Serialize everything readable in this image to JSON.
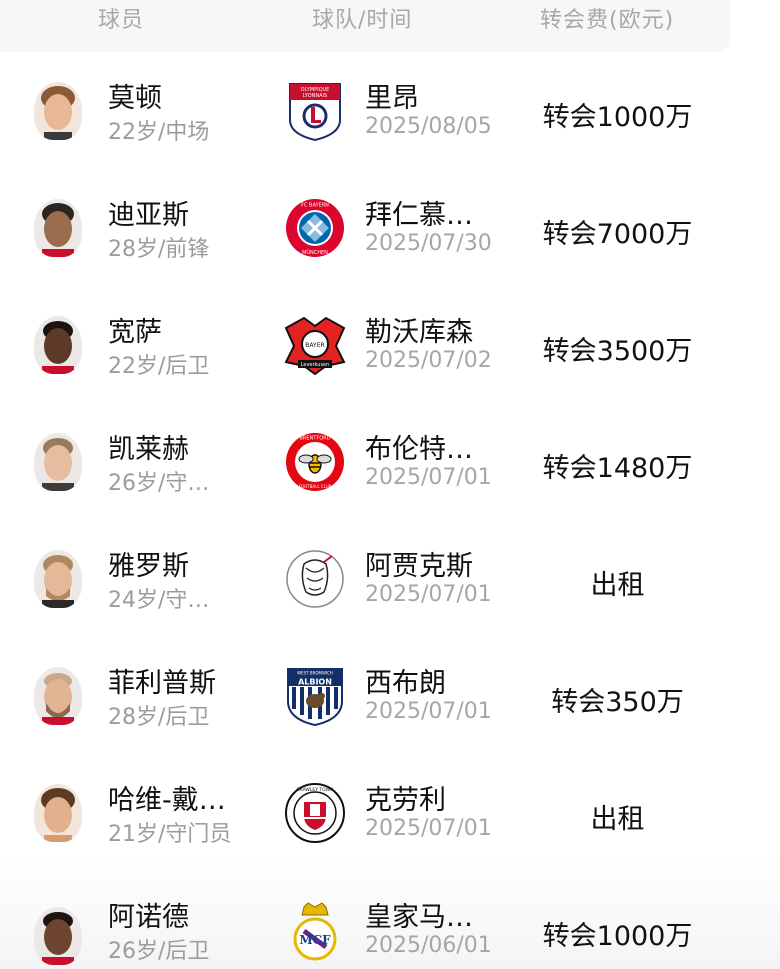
{
  "header": {
    "player_col": "球员",
    "team_col": "球队/时间",
    "fee_col": "转会费(欧元)"
  },
  "rows": [
    {
      "name": "莫顿",
      "info": "22岁/中场",
      "team": "里昂",
      "date": "2025/08/05",
      "fee": "转会1000万",
      "logo": "lyon-logo-icon"
    },
    {
      "name": "迪亚斯",
      "info": "28岁/前锋",
      "team": "拜仁慕…",
      "date": "2025/07/30",
      "fee": "转会7000万",
      "logo": "bayern-logo-icon"
    },
    {
      "name": "宽萨",
      "info": "22岁/后卫",
      "team": "勒沃库森",
      "date": "2025/07/02",
      "fee": "转会3500万",
      "logo": "leverkusen-logo-icon"
    },
    {
      "name": "凯莱赫",
      "info": "26岁/守…",
      "team": "布伦特…",
      "date": "2025/07/01",
      "fee": "转会1480万",
      "logo": "brentford-logo-icon"
    },
    {
      "name": "雅罗斯",
      "info": "24岁/守…",
      "team": "阿贾克斯",
      "date": "2025/07/01",
      "fee": "出租",
      "logo": "ajax-logo-icon"
    },
    {
      "name": "菲利普斯",
      "info": "28岁/后卫",
      "team": "西布朗",
      "date": "2025/07/01",
      "fee": "转会350万",
      "logo": "west-brom-logo-icon"
    },
    {
      "name": "哈维-戴…",
      "info": "21岁/守门员",
      "team": "克劳利",
      "date": "2025/07/01",
      "fee": "出租",
      "logo": "crawley-logo-icon"
    },
    {
      "name": "阿诺德",
      "info": "26岁/后卫",
      "team": "皇家马…",
      "date": "2025/06/01",
      "fee": "转会1000万",
      "logo": "real-madrid-logo-icon"
    }
  ],
  "logo_text": {
    "lyon": "OLYMPIQUE LYONNAIS",
    "bayern": "FC BAYERN MÜNCHEN",
    "leverkusen": "BAYER 04 Leverkusen",
    "brentford": "BRENTFORD FOOTBALL CLUB",
    "west_brom": "WEST BROMWICH ALBION",
    "crawley": "CRAWLEY TOWN FC"
  },
  "colors": {
    "header_text": "#a8a8a8",
    "secondary_text": "#9c9c9c",
    "primary_text": "#111111",
    "header_bg": "#f7f7f9"
  }
}
